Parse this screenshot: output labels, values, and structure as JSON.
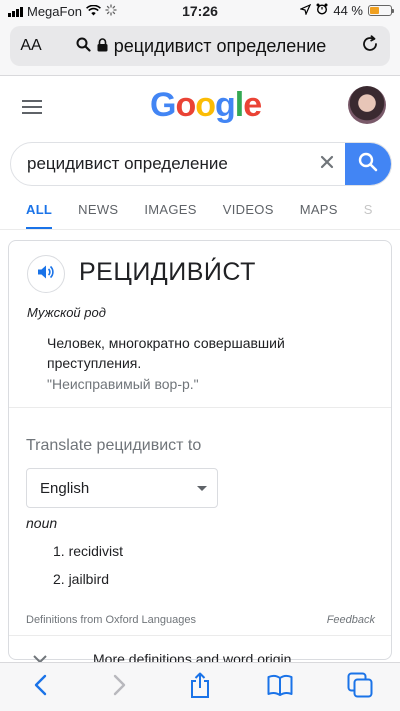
{
  "status_bar": {
    "carrier": "MegaFon",
    "time": "17:26",
    "battery_text": "44 %",
    "battery_level": 0.44
  },
  "browser": {
    "aa_label": "AA",
    "url": "рецидивист определение"
  },
  "google": {
    "logo_letters": [
      {
        "ch": "G",
        "color": "#4285F4"
      },
      {
        "ch": "o",
        "color": "#EA4335"
      },
      {
        "ch": "o",
        "color": "#FBBC05"
      },
      {
        "ch": "g",
        "color": "#4285F4"
      },
      {
        "ch": "l",
        "color": "#34A853"
      },
      {
        "ch": "e",
        "color": "#EA4335"
      }
    ]
  },
  "search": {
    "query": "рецидивист определение"
  },
  "tabs": [
    {
      "label": "ALL",
      "active": true
    },
    {
      "label": "NEWS",
      "active": false
    },
    {
      "label": "IMAGES",
      "active": false
    },
    {
      "label": "VIDEOS",
      "active": false
    },
    {
      "label": "MAPS",
      "active": false
    },
    {
      "label": "S",
      "active": false
    }
  ],
  "dictionary": {
    "word": "РЕЦИДИВИ́СТ",
    "part_of_speech": "Мужской род",
    "definition": "Человек, многократно совершавший преступления.",
    "example": "\"Неисправимый вор-р.\"",
    "translate_label": "Translate рецидивист to",
    "language_selected": "English",
    "translation_pos": "noun",
    "translations": [
      "1. recidivist",
      "2. jailbird"
    ],
    "source_note": "Definitions from Oxford Languages",
    "feedback": "Feedback",
    "more_definitions": "More definitions and word origin"
  },
  "colors": {
    "accent": "#1a73e8",
    "search_button": "#4285f4"
  },
  "icons": [
    "wifi-icon",
    "loading-icon",
    "location-icon",
    "alarm-icon",
    "search-icon",
    "lock-icon",
    "reload-icon",
    "speaker-icon",
    "back-icon",
    "forward-icon",
    "share-icon",
    "bookmarks-icon",
    "tabs-icon"
  ]
}
